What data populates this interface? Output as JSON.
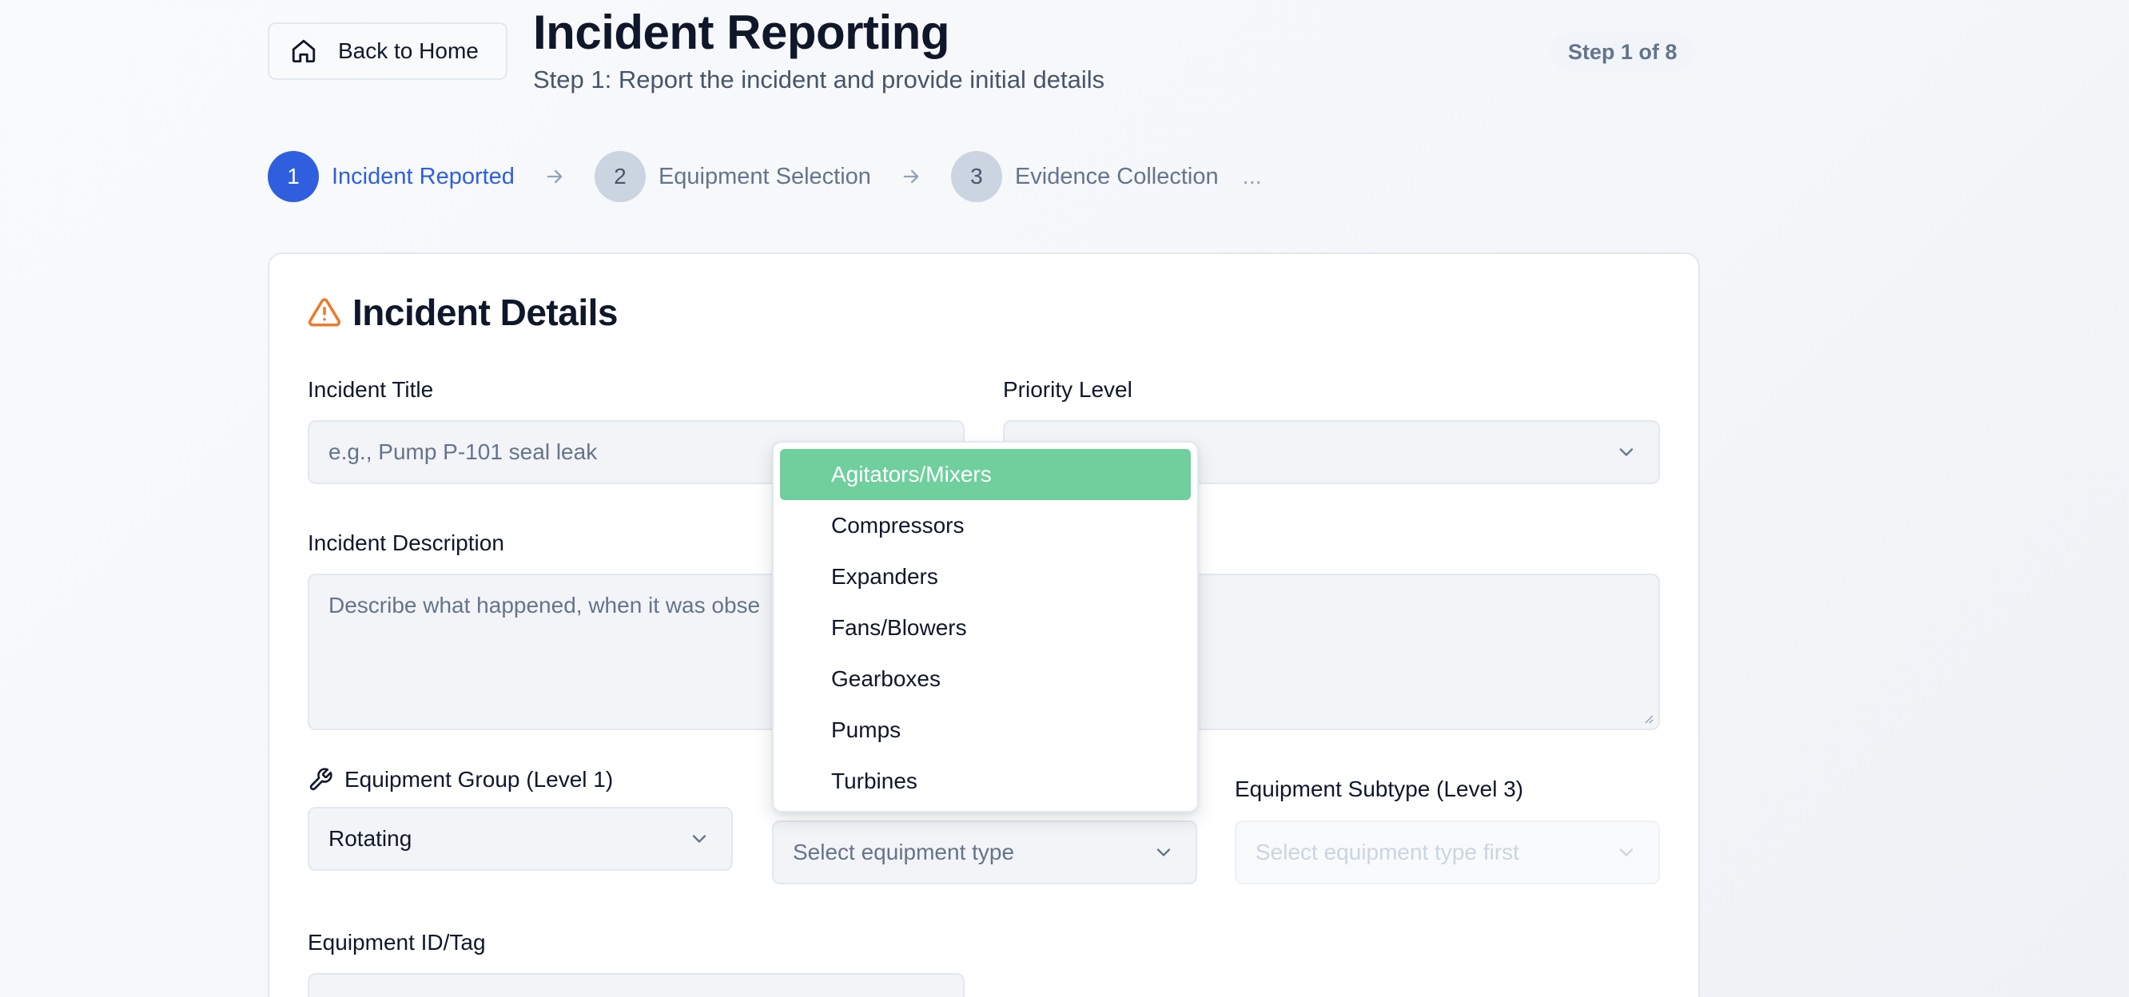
{
  "header": {
    "back_label": "Back to Home",
    "title": "Incident Reporting",
    "subtitle": "Step 1: Report the incident and provide initial details",
    "step_badge": "Step 1 of 8"
  },
  "stepper": {
    "steps": [
      {
        "number": "1",
        "label": "Incident Reported"
      },
      {
        "number": "2",
        "label": "Equipment Selection"
      },
      {
        "number": "3",
        "label": "Evidence Collection"
      }
    ],
    "more": "..."
  },
  "card": {
    "title": "Incident Details",
    "incident_title": {
      "label": "Incident Title",
      "placeholder": "e.g., Pump P-101 seal leak"
    },
    "priority": {
      "label": "Priority Level"
    },
    "description": {
      "label": "Incident Description",
      "placeholder": "Describe what happened, when it was obse"
    },
    "equipment_group": {
      "label": "Equipment Group (Level 1)",
      "value": "Rotating"
    },
    "equipment_type": {
      "placeholder": "Select equipment type"
    },
    "equipment_subtype": {
      "label": "Equipment Subtype (Level 3)",
      "placeholder": "Select equipment type first"
    },
    "equipment_id": {
      "label": "Equipment ID/Tag"
    }
  },
  "dropdown": {
    "options": [
      "Agitators/Mixers",
      "Compressors",
      "Expanders",
      "Fans/Blowers",
      "Gearboxes",
      "Pumps",
      "Turbines"
    ],
    "highlighted": "Agitators/Mixers"
  },
  "colors": {
    "primary": "#2f5fde",
    "highlight": "#6fcf9d",
    "warning": "#ea7a2a"
  },
  "icons": {
    "back": "home-icon",
    "title": "warning-triangle-icon",
    "group": "wrench-icon",
    "chevron": "chevron-down-icon",
    "arrow": "arrow-right-icon"
  }
}
